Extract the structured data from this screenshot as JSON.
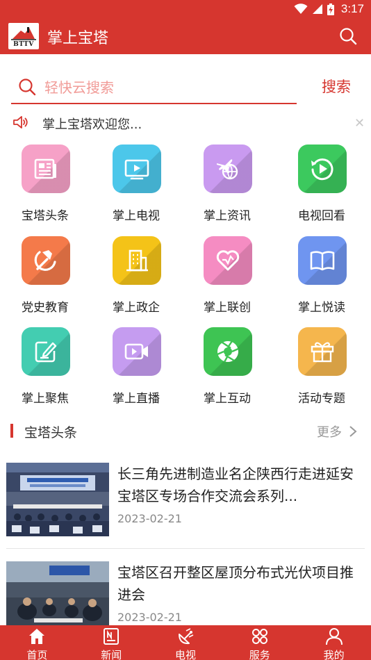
{
  "status": {
    "time": "3:17"
  },
  "app": {
    "title": "掌上宝塔",
    "logo_text": "BTTV"
  },
  "search": {
    "placeholder": "轻快云搜索",
    "value": "",
    "button_label": "搜索"
  },
  "notice": {
    "text": "掌上宝塔欢迎您...",
    "close_label": "✕"
  },
  "grid": {
    "items": [
      {
        "label": "宝塔头条",
        "icon": "newspaper-icon",
        "color": "#f6a1c7"
      },
      {
        "label": "掌上电视",
        "icon": "tv-icon",
        "color": "#4cc7ea"
      },
      {
        "label": "掌上资讯",
        "icon": "plane-globe-icon",
        "color": "#c99af0"
      },
      {
        "label": "电视回看",
        "icon": "replay-icon",
        "color": "#3cc95e"
      },
      {
        "label": "党史教育",
        "icon": "hammer-sickle-icon",
        "color": "#f47a4a"
      },
      {
        "label": "掌上政企",
        "icon": "building-icon",
        "color": "#f4c318"
      },
      {
        "label": "掌上联创",
        "icon": "heart-icon",
        "color": "#f58cc2"
      },
      {
        "label": "掌上悦读",
        "icon": "book-icon",
        "color": "#6f95f0"
      },
      {
        "label": "掌上聚焦",
        "icon": "note-edit-icon",
        "color": "#43cdb1"
      },
      {
        "label": "掌上直播",
        "icon": "video-camera-icon",
        "color": "#c59cf0"
      },
      {
        "label": "掌上互动",
        "icon": "aperture-icon",
        "color": "#3ec453"
      },
      {
        "label": "活动专题",
        "icon": "gift-icon",
        "color": "#f5b64d"
      }
    ]
  },
  "section": {
    "title": "宝塔头条",
    "more_label": "更多"
  },
  "news": [
    {
      "title": "长三角先进制造业名企陕西行走进延安宝塔区专场合作交流会系列...",
      "date": "2023-02-21"
    },
    {
      "title": "宝塔区召开整区屋顶分布式光伏项目推进会",
      "date": "2023-02-21"
    }
  ],
  "nav": [
    {
      "label": "首页",
      "icon": "home-icon"
    },
    {
      "label": "新闻",
      "icon": "news-icon"
    },
    {
      "label": "电视",
      "icon": "tv-antenna-icon"
    },
    {
      "label": "服务",
      "icon": "services-icon"
    },
    {
      "label": "我的",
      "icon": "user-icon"
    }
  ]
}
